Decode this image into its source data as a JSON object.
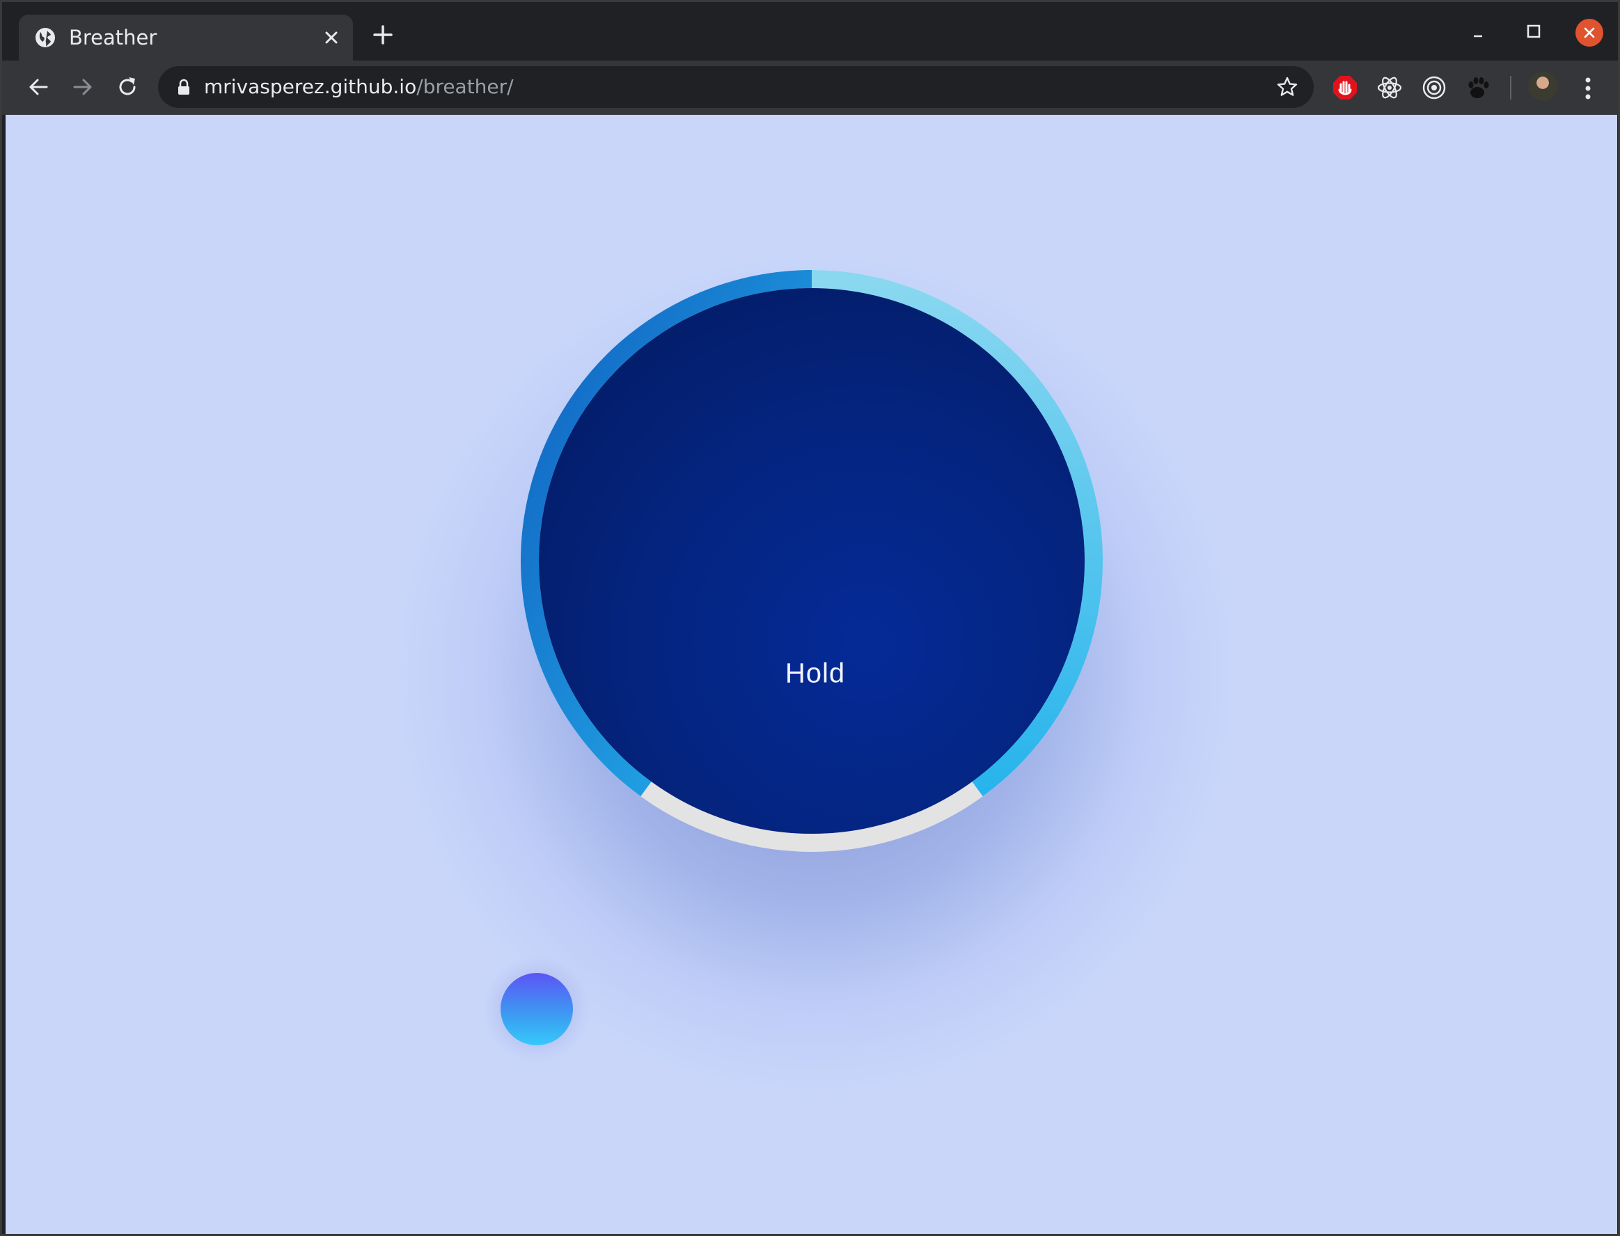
{
  "browser": {
    "tab": {
      "title": "Breather"
    },
    "address_bar": {
      "host": "mrivasperez.github.io",
      "path": "/breather/"
    }
  },
  "app": {
    "phase_label": "Hold",
    "progress_fraction": 0.8
  },
  "colors": {
    "page_background": "#c9d6fa",
    "circle_inner": "#041f73",
    "circle_edge": "#062c9c",
    "ring_track": "#e3e3e3",
    "ring_start": "#0f6ac4",
    "ring_end": "#29b5ec",
    "ball_top": "#5b55f5",
    "ball_bottom": "#36c9fb"
  },
  "icons": {
    "tab_favicon": "globe-icon",
    "tab_close": "close-icon",
    "new_tab": "plus-icon",
    "back": "arrow-left-icon",
    "forward": "arrow-right-icon",
    "reload": "reload-icon",
    "secure": "lock-icon",
    "bookmark": "star-icon",
    "ext_block": "ublock-icon",
    "ext_react": "react-icon",
    "ext_target": "target-icon",
    "ext_paw": "paw-icon",
    "menu": "kebab-menu-icon"
  }
}
